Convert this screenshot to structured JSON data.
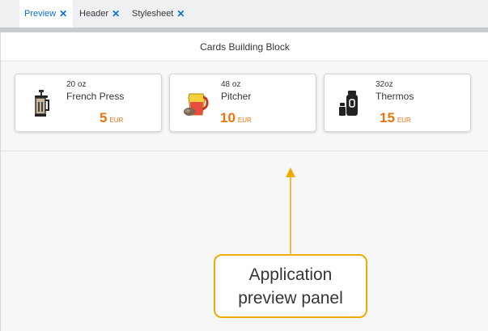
{
  "tabs": [
    {
      "label": "Preview",
      "active": true
    },
    {
      "label": "Header",
      "active": false
    },
    {
      "label": "Stylesheet",
      "active": false
    }
  ],
  "close_glyph": "✕",
  "preview": {
    "title": "Cards Building Block",
    "cards": [
      {
        "size": "20 oz",
        "name": "French Press",
        "price": "5",
        "currency": "EUR",
        "icon": "french-press-icon"
      },
      {
        "size": "48 oz",
        "name": "Pitcher",
        "price": "10",
        "currency": "EUR",
        "icon": "pitcher-icon"
      },
      {
        "size": "32oz",
        "name": "Thermos",
        "price": "15",
        "currency": "EUR",
        "icon": "thermos-icon"
      }
    ]
  },
  "annotation": {
    "text": "Application preview panel",
    "border_color": "#f0ab00"
  },
  "colors": {
    "accent": "#0a6ed1",
    "price": "#e9730c"
  }
}
